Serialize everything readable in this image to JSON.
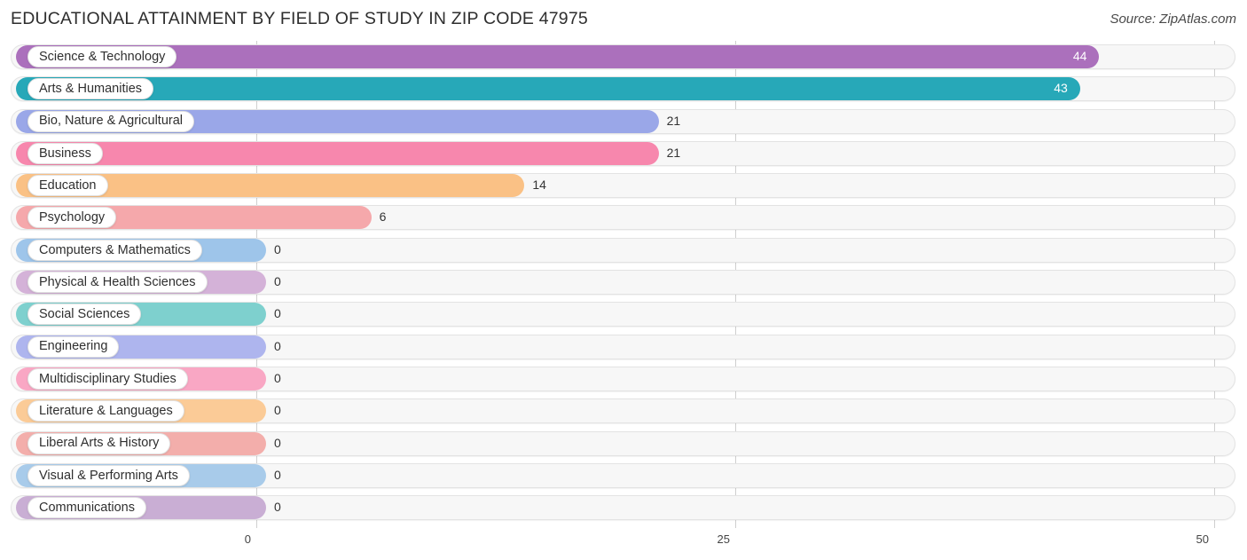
{
  "header": {
    "title": "EDUCATIONAL ATTAINMENT BY FIELD OF STUDY IN ZIP CODE 47975",
    "source": "Source: ZipAtlas.com"
  },
  "chart_data": {
    "type": "bar",
    "orientation": "horizontal",
    "title": "EDUCATIONAL ATTAINMENT BY FIELD OF STUDY IN ZIP CODE 47975",
    "xlabel": "",
    "ylabel": "",
    "xlim": [
      0,
      50
    ],
    "ticks": [
      "0",
      "25",
      "50"
    ],
    "grid": true,
    "legend": "none",
    "categories": [
      "Science & Technology",
      "Arts & Humanities",
      "Bio, Nature & Agricultural",
      "Business",
      "Education",
      "Psychology",
      "Computers & Mathematics",
      "Physical & Health Sciences",
      "Social Sciences",
      "Engineering",
      "Multidisciplinary Studies",
      "Literature & Languages",
      "Liberal Arts & History",
      "Visual & Performing Arts",
      "Communications"
    ],
    "values": [
      44,
      43,
      21,
      21,
      14,
      6,
      0,
      0,
      0,
      0,
      0,
      0,
      0,
      0,
      0
    ],
    "value_labels": [
      "44",
      "43",
      "21",
      "21",
      "14",
      "6",
      "0",
      "0",
      "0",
      "0",
      "0",
      "0",
      "0",
      "0",
      "0"
    ],
    "colors": [
      "#ab70bc",
      "#27a8b8",
      "#9aa7e8",
      "#f787ad",
      "#fac185",
      "#f5a8ab",
      "#9ec5ea",
      "#d4b2d8",
      "#7ed0ce",
      "#aeb5ee",
      "#f9a7c4",
      "#fbcb97",
      "#f3aeab",
      "#a8cbea",
      "#c9aed4"
    ],
    "label_inside": [
      true,
      true,
      false,
      false,
      false,
      false,
      false,
      false,
      false,
      false,
      false,
      false,
      false,
      false,
      false
    ]
  }
}
